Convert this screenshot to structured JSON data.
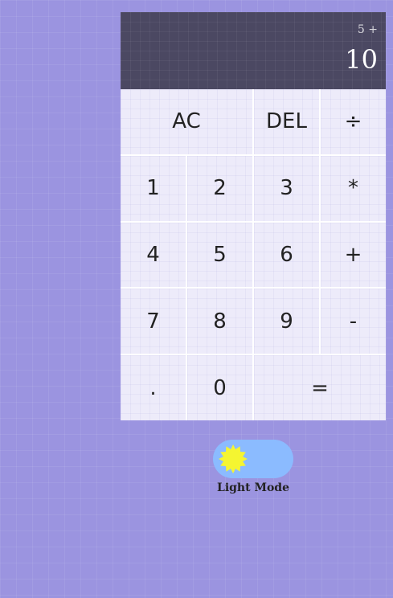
{
  "display": {
    "previous": "5 +",
    "current": "10"
  },
  "keys": {
    "ac": "AC",
    "del": "DEL",
    "divide": "÷",
    "one": "1",
    "two": "2",
    "three": "3",
    "multiply": "*",
    "four": "4",
    "five": "5",
    "six": "6",
    "plus": "+",
    "seven": "7",
    "eight": "8",
    "nine": "9",
    "minus": "-",
    "dot": ".",
    "zero": "0",
    "equals": "="
  },
  "theme_toggle": {
    "label": "Light Mode",
    "icon": "sun-icon",
    "enabled": true
  },
  "colors": {
    "background": "#9b94e0",
    "display": "#4b4862",
    "toggle_track": "#8bbbff",
    "sun": "#f5f531"
  }
}
